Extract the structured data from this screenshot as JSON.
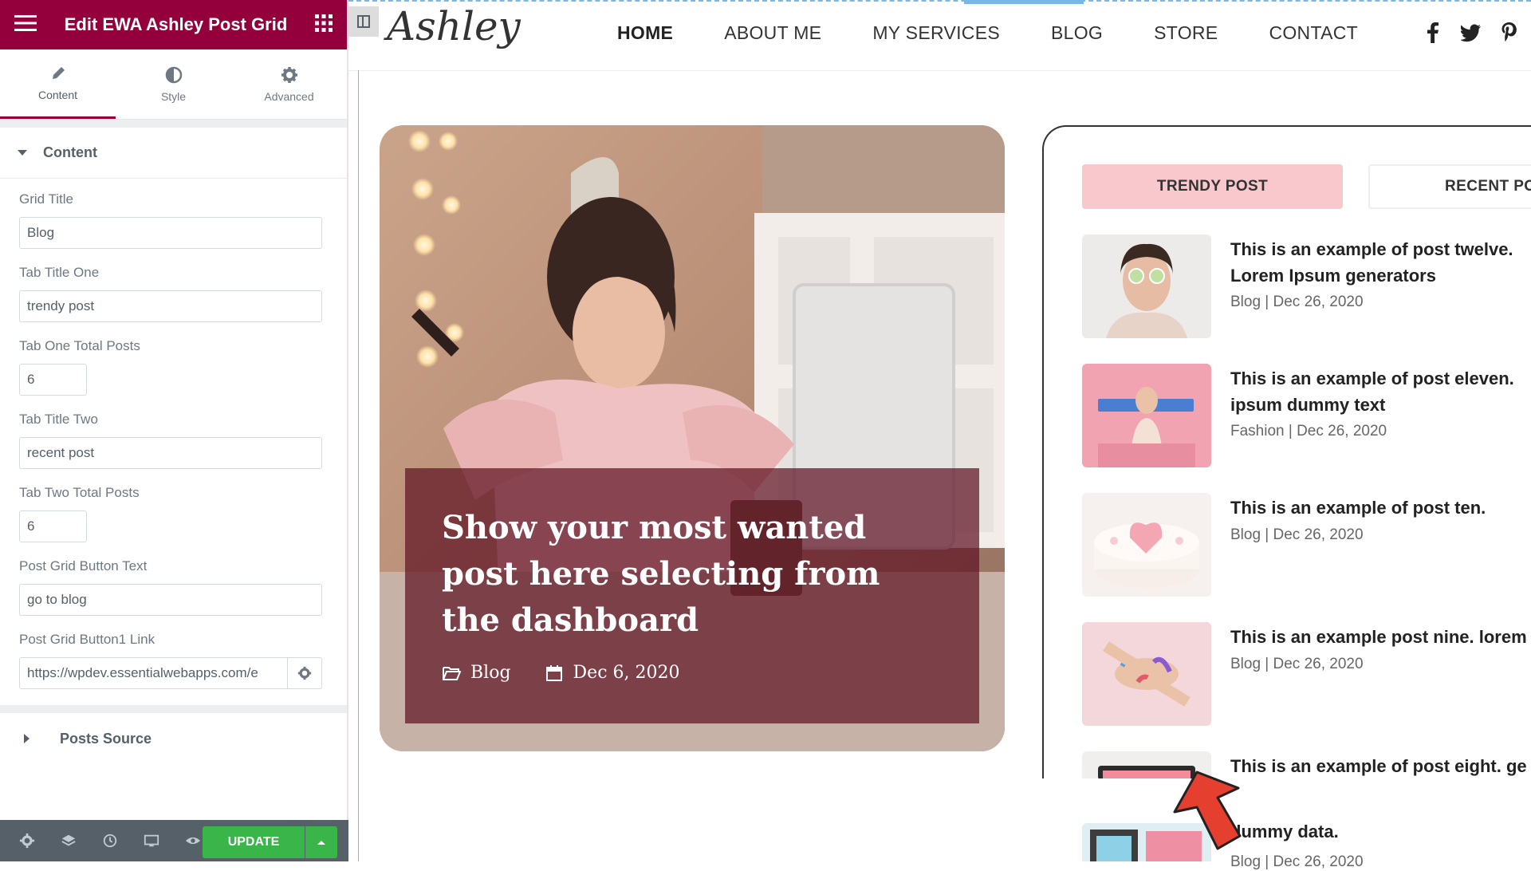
{
  "editor": {
    "header_title": "Edit EWA Ashley Post Grid",
    "tabs": [
      {
        "label": "Content",
        "icon": "pencil-icon",
        "active": true
      },
      {
        "label": "Style",
        "icon": "half-circle-icon",
        "active": false
      },
      {
        "label": "Advanced",
        "icon": "gear-icon",
        "active": false
      }
    ],
    "section_content": "Content",
    "controls": {
      "grid_title_label": "Grid Title",
      "grid_title_value": "Blog",
      "tab_one_title_label": "Tab Title One",
      "tab_one_title_value": "trendy post",
      "tab_one_total_label": "Tab One Total Posts",
      "tab_one_total_value": "6",
      "tab_two_title_label": "Tab Title Two",
      "tab_two_title_value": "recent post",
      "tab_two_total_label": "Tab Two Total Posts",
      "tab_two_total_value": "6",
      "button_text_label": "Post Grid Button Text",
      "button_text_value": "go to blog",
      "button_link_label": "Post Grid Button1 Link",
      "button_link_value": "https://wpdev.essentialwebapps.com/e"
    },
    "section_posts_source": "Posts Source",
    "update_label": "UPDATE",
    "accent_color": "#93003c",
    "update_color": "#39b54a"
  },
  "site": {
    "logo": "Ashley",
    "nav": [
      "HOME",
      "ABOUT ME",
      "MY SERVICES",
      "BLOG",
      "STORE",
      "CONTACT"
    ],
    "active_nav": "HOME",
    "social_icons": [
      "facebook-icon",
      "twitter-icon",
      "pinterest-icon"
    ],
    "feature": {
      "title": "Show your most wanted post here selecting from the dashboard",
      "category": "Blog",
      "date": "Dec 6, 2020"
    },
    "post_tabs": [
      "TRENDY POST",
      "RECENT PO"
    ],
    "posts": [
      {
        "title": "This is an example of post twelve. ",
        "title_line2": "Lorem Ipsum generators",
        "meta": "Blog | Dec 26, 2020"
      },
      {
        "title": "This is an example of post eleven. ",
        "title_line2": "ipsum dummy text",
        "meta": "Fashion | Dec 26, 2020"
      },
      {
        "title": "This is an example of post ten.",
        "title_line2": "",
        "meta": "Blog | Dec 26, 2020"
      },
      {
        "title": "This is an example post nine. lorem",
        "title_line2": "",
        "meta": "Blog | Dec 26, 2020"
      },
      {
        "title": "This is an example of post eight. ge",
        "title_line2": "",
        "meta": ""
      }
    ],
    "partial_post": {
      "title": "dummy data.",
      "meta": "Blog | Dec 26, 2020"
    },
    "tab_active_color": "#f8c8cc"
  }
}
